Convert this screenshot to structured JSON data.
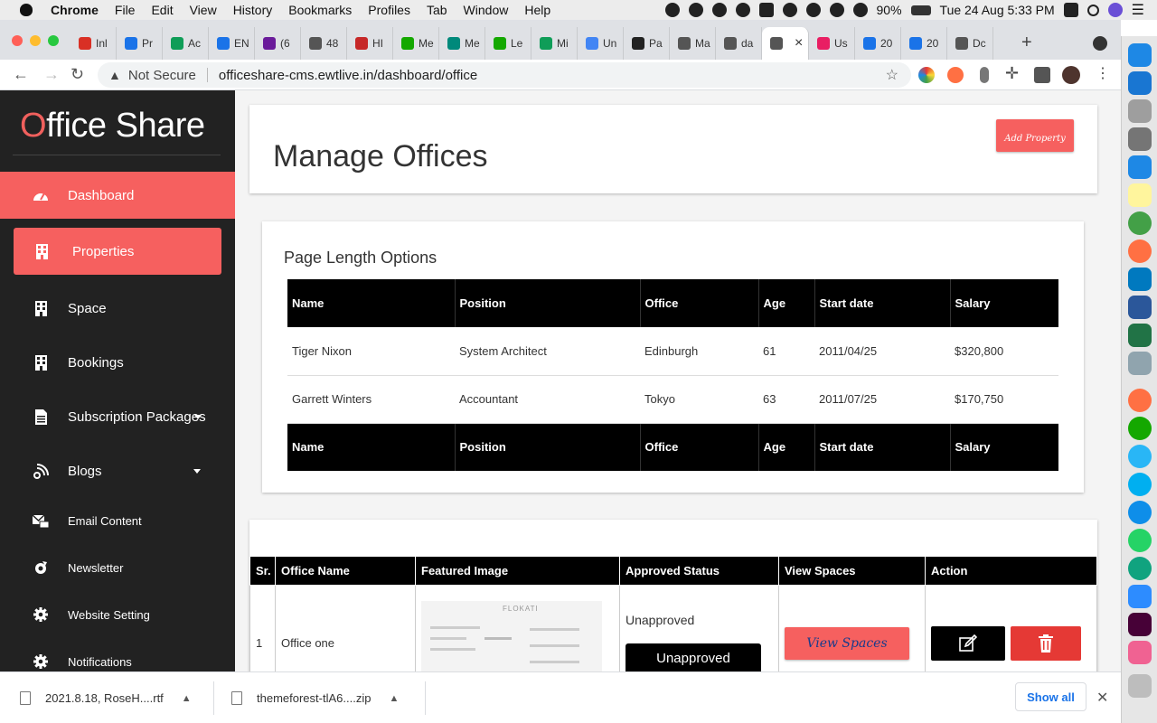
{
  "menubar": {
    "app": "Chrome",
    "items": [
      "File",
      "Edit",
      "View",
      "History",
      "Bookmarks",
      "Profiles",
      "Tab",
      "Window",
      "Help"
    ],
    "battery": "90%",
    "datetime": "Tue 24 Aug  5:33 PM"
  },
  "browser": {
    "tabs": [
      {
        "label": "Inl",
        "color": "#d93025"
      },
      {
        "label": "Pr",
        "color": "#1a73e8"
      },
      {
        "label": "Ac",
        "color": "#0f9d58"
      },
      {
        "label": "EN",
        "color": "#1a73e8"
      },
      {
        "label": "(6",
        "color": "#6a1b9a"
      },
      {
        "label": "48",
        "color": "#555555"
      },
      {
        "label": "HI",
        "color": "#c62828"
      },
      {
        "label": "Me",
        "color": "#14a800"
      },
      {
        "label": "Me",
        "color": "#00897b"
      },
      {
        "label": "Le",
        "color": "#14a800"
      },
      {
        "label": "Mi",
        "color": "#0f9d58"
      },
      {
        "label": "Un",
        "color": "#4285f4"
      },
      {
        "label": "Pa",
        "color": "#222222"
      },
      {
        "label": "Ma",
        "color": "#555555"
      },
      {
        "label": "da",
        "color": "#555555"
      },
      {
        "label": "",
        "color": "#555555",
        "active": true
      },
      {
        "label": "Us",
        "color": "#e91e63"
      },
      {
        "label": "20",
        "color": "#1a73e8"
      },
      {
        "label": "20",
        "color": "#1a73e8"
      },
      {
        "label": "Dc",
        "color": "#555555"
      }
    ],
    "new_tab": "+",
    "security": "Not Secure",
    "url": "officeshare-cms.ewtlive.in/dashboard/office"
  },
  "sidebar": {
    "logo_first": "O",
    "logo_rest": "ffice Share",
    "items": [
      {
        "label": "Dashboard",
        "icon": "dashboard-icon"
      },
      {
        "label": "Properties",
        "icon": "building-icon"
      },
      {
        "label": "Space",
        "icon": "building-icon"
      },
      {
        "label": "Bookings",
        "icon": "building-icon"
      },
      {
        "label": "Subscription Packages",
        "icon": "document-icon"
      },
      {
        "label": "Blogs",
        "icon": "blog-icon"
      },
      {
        "label": "Email Content",
        "icon": "email-icon"
      },
      {
        "label": "Newsletter",
        "icon": "newsletter-icon"
      },
      {
        "label": "Website Setting",
        "icon": "gear-icon"
      },
      {
        "label": "Notifications",
        "icon": "gear-icon"
      }
    ]
  },
  "header": {
    "title": "Manage Offices",
    "add_button": "Add Property"
  },
  "page_length": {
    "title": "Page Length Options",
    "columns": [
      "Name",
      "Position",
      "Office",
      "Age",
      "Start date",
      "Salary"
    ],
    "rows": [
      [
        "Tiger Nixon",
        "System Architect",
        "Edinburgh",
        "61",
        "2011/04/25",
        "$320,800"
      ],
      [
        "Garrett Winters",
        "Accountant",
        "Tokyo",
        "63",
        "2011/07/25",
        "$170,750"
      ]
    ]
  },
  "offices": {
    "columns": [
      "Sr.",
      "Office Name",
      "Featured Image",
      "Approved Status",
      "View Spaces",
      "Action"
    ],
    "rows": [
      {
        "sr": "1",
        "name": "Office one",
        "image_brand": "FLOKATI",
        "status_text": "Unapproved",
        "status_button": "Unapproved",
        "view_button": "View Spaces"
      }
    ]
  },
  "downloads": {
    "items": [
      "2021.8.18, RoseH....rtf",
      "themeforest-tlA6....zip"
    ],
    "show_all": "Show all"
  },
  "colors": {
    "accent": "#f6605f",
    "sidebar_bg": "#222222",
    "delete": "#e53935"
  }
}
